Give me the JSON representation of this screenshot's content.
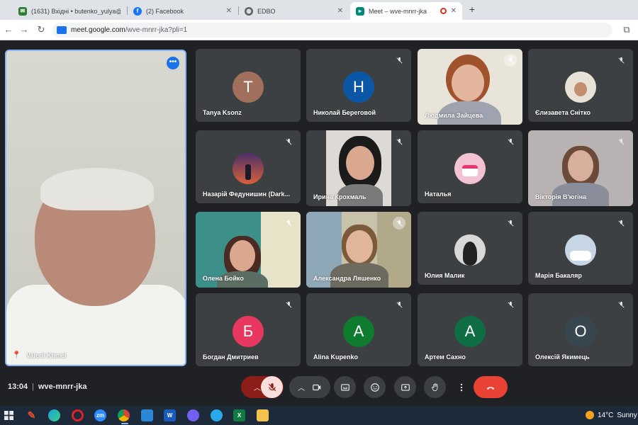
{
  "browser": {
    "tabs": [
      {
        "title": "(1631) Вхідні • butenko_yulya@",
        "favicon": "mail-icon",
        "color": "#2e7d32"
      },
      {
        "title": "(2) Facebook",
        "favicon": "facebook-icon",
        "color": "#1877f2"
      },
      {
        "title": "EDBO",
        "favicon": "globe-icon",
        "color": "#5f6368"
      },
      {
        "title": "Meet – wve-mnrr-jka",
        "favicon": "meet-icon",
        "color": "#00897b"
      }
    ],
    "url_host": "meet.google.com",
    "url_path": "/wve-mnrr-jka?pli=1"
  },
  "meet": {
    "self_name": "Valerii Khmel",
    "participants": [
      {
        "name": "Tanya Ksonz",
        "initial": "T",
        "avatar_color": "#a1705d",
        "type": "initial"
      },
      {
        "name": "Николай Береговой",
        "initial": "Н",
        "avatar_color": "#0b57a6",
        "type": "initial"
      },
      {
        "name": "Людмила Зайцева",
        "type": "video",
        "bg": "#e9e4da"
      },
      {
        "name": "Єлизавета Снітко",
        "type": "photo",
        "bg": "#e8e1d6"
      },
      {
        "name": "Назарій Федунишин (Dark...",
        "type": "photo",
        "bg": "#7b4f8e"
      },
      {
        "name": "Ирина Крохмаль",
        "type": "video",
        "bg": "#ddd9d4"
      },
      {
        "name": "Наталья",
        "type": "photo",
        "bg": "#f3c2d3"
      },
      {
        "name": "Вікторія В'югіна",
        "type": "video",
        "bg": "#b9b2b2"
      },
      {
        "name": "Олена Бойко",
        "type": "video",
        "bg": "#3d8f8a"
      },
      {
        "name": "Александра Ляшенко",
        "type": "video",
        "bg": "#c8c2aa"
      },
      {
        "name": "Юлия Малик",
        "type": "photo",
        "bg": "#d8d8d8"
      },
      {
        "name": "Марія Бакаляр",
        "type": "photo",
        "bg": "#c7d6e4"
      },
      {
        "name": "Богдан Дмитриев",
        "initial": "Б",
        "avatar_color": "#e8385f",
        "type": "initial"
      },
      {
        "name": "Alina Kupenko",
        "initial": "A",
        "avatar_color": "#0f7b2f",
        "type": "initial"
      },
      {
        "name": "Артем Сахно",
        "initial": "A",
        "avatar_color": "#0f6d43",
        "type": "initial"
      },
      {
        "name": "Олексій Якимець",
        "initial": "O",
        "avatar_color": "#37474f",
        "type": "initial"
      }
    ],
    "time": "13:04",
    "meeting_code": "wve-mnrr-jka"
  },
  "controls": {
    "buttons": [
      "mic-off-icon",
      "camera-icon",
      "captions-icon",
      "emoji-icon",
      "present-icon",
      "raise-hand-icon",
      "more-options-icon",
      "end-call-icon"
    ],
    "end_call_color": "#ea4335",
    "mic_active_color": "#f9dedc"
  },
  "taskbar": {
    "weather_temp": "14°C",
    "weather_text": "Sunny",
    "apps": [
      "windows-icon",
      "paint-icon",
      "edge-icon",
      "opera-icon",
      "zoom-icon",
      "chrome-icon",
      "store-icon",
      "word-icon",
      "viber-icon",
      "telegram-icon",
      "excel-icon",
      "folder-icon"
    ],
    "zoom_label": "zm",
    "word_label": "W",
    "excel_label": "X"
  }
}
